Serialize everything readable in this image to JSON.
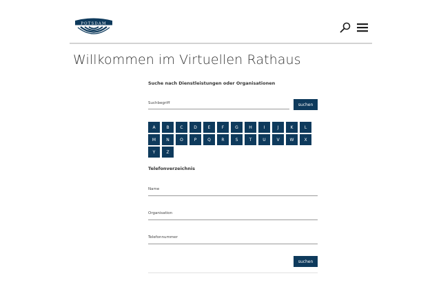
{
  "header": {
    "logo_text": "POTSDAM",
    "search_icon": "magnifier-icon",
    "menu_icon": "hamburger-menu-icon"
  },
  "page": {
    "title": "Willkommen im Virtuellen Rathaus"
  },
  "service_search": {
    "heading": "Suche nach Dienstleistungen oder Organisationen",
    "field_label": "Suchbegriff",
    "field_value": "",
    "button_label": "suchen",
    "letters": [
      "A",
      "B",
      "C",
      "D",
      "E",
      "F",
      "G",
      "H",
      "I",
      "J",
      "K",
      "L",
      "M",
      "N",
      "O",
      "P",
      "Q",
      "R",
      "S",
      "T",
      "U",
      "V",
      "W",
      "X",
      "Y",
      "Z"
    ]
  },
  "phone_directory": {
    "heading": "Telefonverzeichnis",
    "name_label": "Name",
    "name_value": "",
    "org_label": "Organisation",
    "org_value": "",
    "phone_label": "Telefonnummer",
    "phone_value": "",
    "button_label": "suchen"
  },
  "colors": {
    "primary": "#0e3a5c",
    "rule": "#d2d2d2"
  }
}
